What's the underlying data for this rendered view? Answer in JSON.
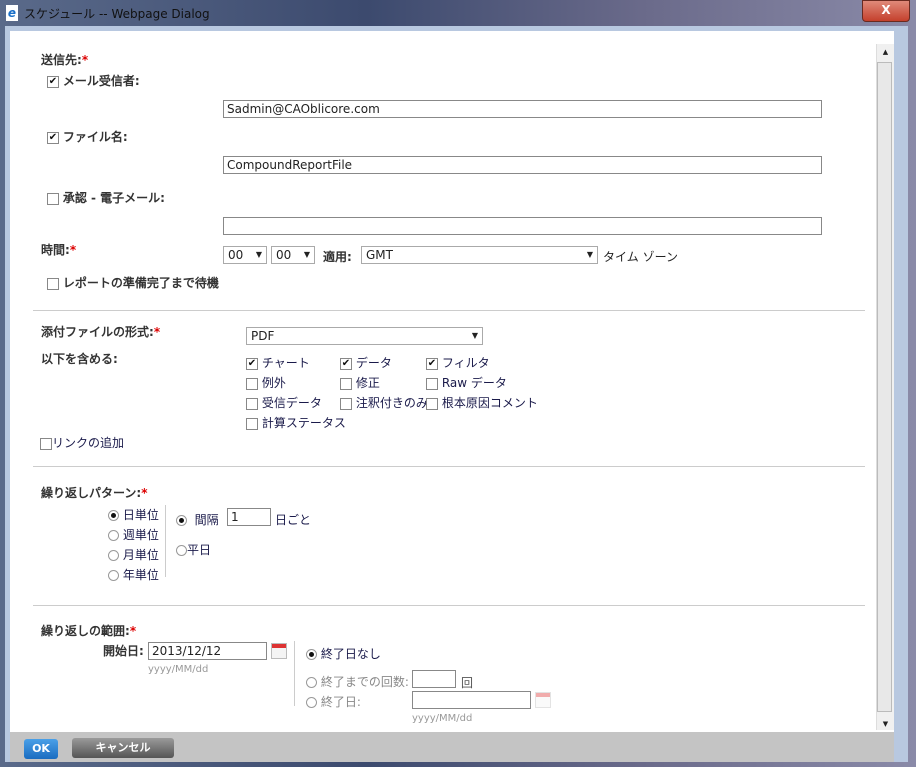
{
  "window": {
    "title": "スケジュール -- Webpage Dialog",
    "close": "X"
  },
  "recipients": {
    "label": "送信先:",
    "required": "*",
    "mail": {
      "label": "メール受信者:",
      "checked": true,
      "value": "Sadmin@CAOblicore.com"
    },
    "file": {
      "label": "ファイル名:",
      "checked": true,
      "value": "CompoundReportFile"
    },
    "approval": {
      "label": "承認  - 電子メール:",
      "checked": false,
      "value": ""
    }
  },
  "time": {
    "label": "時間:",
    "required": "*",
    "hour": "00",
    "minute": "00",
    "apply_label": "適用:",
    "timezone": "GMT",
    "timezone_suffix": "タイム ゾーン",
    "wait_label": "レポートの準備完了まで待機"
  },
  "attachment": {
    "format_label": "添付ファイルの形式:",
    "required": "*",
    "format": "PDF",
    "include_label": "以下を含める:",
    "options": [
      {
        "label": "チャート",
        "checked": true
      },
      {
        "label": "データ",
        "checked": true
      },
      {
        "label": "フィルタ",
        "checked": true
      },
      {
        "label": "例外",
        "checked": false
      },
      {
        "label": "修正",
        "checked": false
      },
      {
        "label": "Raw データ",
        "checked": false
      },
      {
        "label": "受信データ",
        "checked": false
      },
      {
        "label": "注釈付きのみ",
        "checked": false
      },
      {
        "label": "根本原因コメント",
        "checked": false
      },
      {
        "label": "計算ステータス",
        "checked": false
      }
    ],
    "add_link": "リンクの追加"
  },
  "recurrence": {
    "label": "繰り返しパターン:",
    "required": "*",
    "types": [
      "日単位",
      "週単位",
      "月単位",
      "年単位"
    ],
    "selected": 0,
    "interval_label": "間隔",
    "interval": "1",
    "interval_suffix": "日ごと",
    "weekday": "平日"
  },
  "range": {
    "label": "繰り返しの範囲:",
    "required": "*",
    "start_label": "開始日:",
    "start": "2013/12/12",
    "format_hint": "yyyy/MM/dd",
    "no_end": "終了日なし",
    "count_label": "終了までの回数:",
    "count_suffix": "回",
    "end_label": "終了日:",
    "end_hint": "yyyy/MM/dd"
  },
  "buttons": {
    "ok": "OK",
    "cancel": "キャンセル"
  }
}
